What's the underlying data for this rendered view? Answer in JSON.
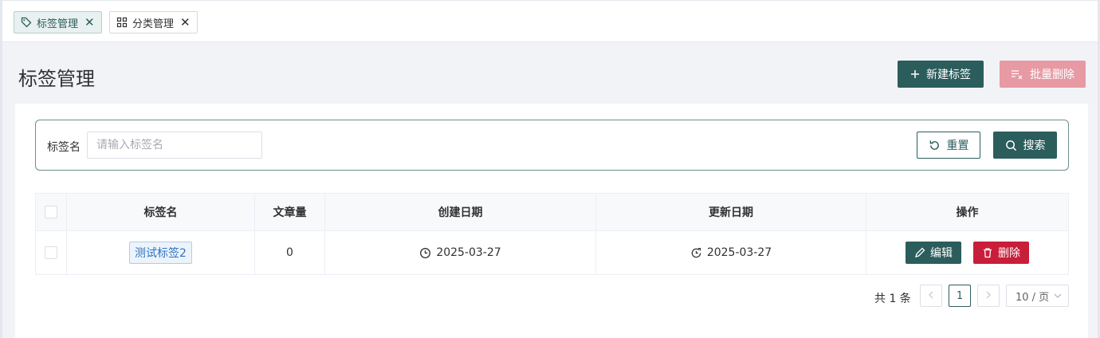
{
  "tabs": [
    {
      "label": "标签管理",
      "icon": "tag-icon",
      "active": true
    },
    {
      "label": "分类管理",
      "icon": "grid-icon",
      "active": false
    }
  ],
  "page": {
    "title": "标签管理",
    "new_button": "新建标签",
    "batch_delete_button": "批量删除"
  },
  "search": {
    "label": "标签名",
    "placeholder": "请输入标签名",
    "reset_button": "重置",
    "search_button": "搜索"
  },
  "table": {
    "columns": [
      "标签名",
      "文章量",
      "创建日期",
      "更新日期",
      "操作"
    ],
    "rows": [
      {
        "name": "测试标签2",
        "count": "0",
        "created": "2025-03-27",
        "updated": "2025-03-27"
      }
    ],
    "edit_label": "编辑",
    "delete_label": "删除"
  },
  "pagination": {
    "total_text": "共 1 条",
    "current_page": "1",
    "page_size": "10 / 页"
  },
  "colors": {
    "primary": "#2b5d5c",
    "danger": "#c91e3a",
    "danger_disabled": "#e79aa4",
    "tag_blue": "#2f74c0"
  }
}
